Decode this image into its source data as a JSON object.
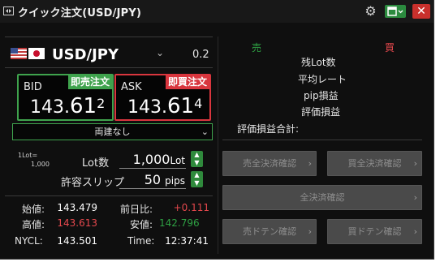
{
  "window": {
    "title": "クイック注文(USD/JPY)",
    "close_label": "✕",
    "gear_glyph": "⚙"
  },
  "colors": {
    "buy_accent": "#d9363e",
    "sell_accent": "#3fa34d",
    "positive": "#2ea043",
    "negative": "#e5484d",
    "background": "#0f0f0f"
  },
  "pair": {
    "symbol": "USD/JPY",
    "spread": "0.2",
    "flags": [
      "us-flag",
      "jp-flag"
    ]
  },
  "bid": {
    "label": "BID",
    "tag": "即売注文",
    "price_main": "143.",
    "price_pip": "61",
    "price_frac": "2"
  },
  "ask": {
    "label": "ASK",
    "tag": "即買注文",
    "price_main": "143.",
    "price_pip": "61",
    "price_frac": "4"
  },
  "hedge": {
    "selected": "両建なし"
  },
  "lot_info": {
    "line1": "1Lot=",
    "line2": "1,000"
  },
  "order": {
    "lot_label": "Lot数",
    "lot_value": "1,000",
    "lot_unit": "Lot",
    "slip_label": "許容スリップ",
    "slip_value": "50",
    "slip_unit": "pips"
  },
  "stats": {
    "open_label": "始値:",
    "open_value": "143.479",
    "change_label": "前日比:",
    "change_value": "+0.111",
    "high_label": "高値:",
    "high_value": "143.613",
    "low_label": "安値:",
    "low_value": "142.796",
    "nycl_label": "NYCL:",
    "nycl_value": "143.501",
    "time_label": "Time:",
    "time_value": "12:37:41"
  },
  "position": {
    "sell_header": "売",
    "buy_header": "買",
    "rows": [
      "残Lot数",
      "平均レート",
      "pip損益",
      "評価損益"
    ],
    "total_label": "評価損益合計:"
  },
  "buttons": {
    "sell_close_all": "売全決済確認",
    "buy_close_all": "買全決済確認",
    "close_all": "全決済確認",
    "sell_doten": "売ドテン確認",
    "buy_doten": "買ドテン確認"
  }
}
